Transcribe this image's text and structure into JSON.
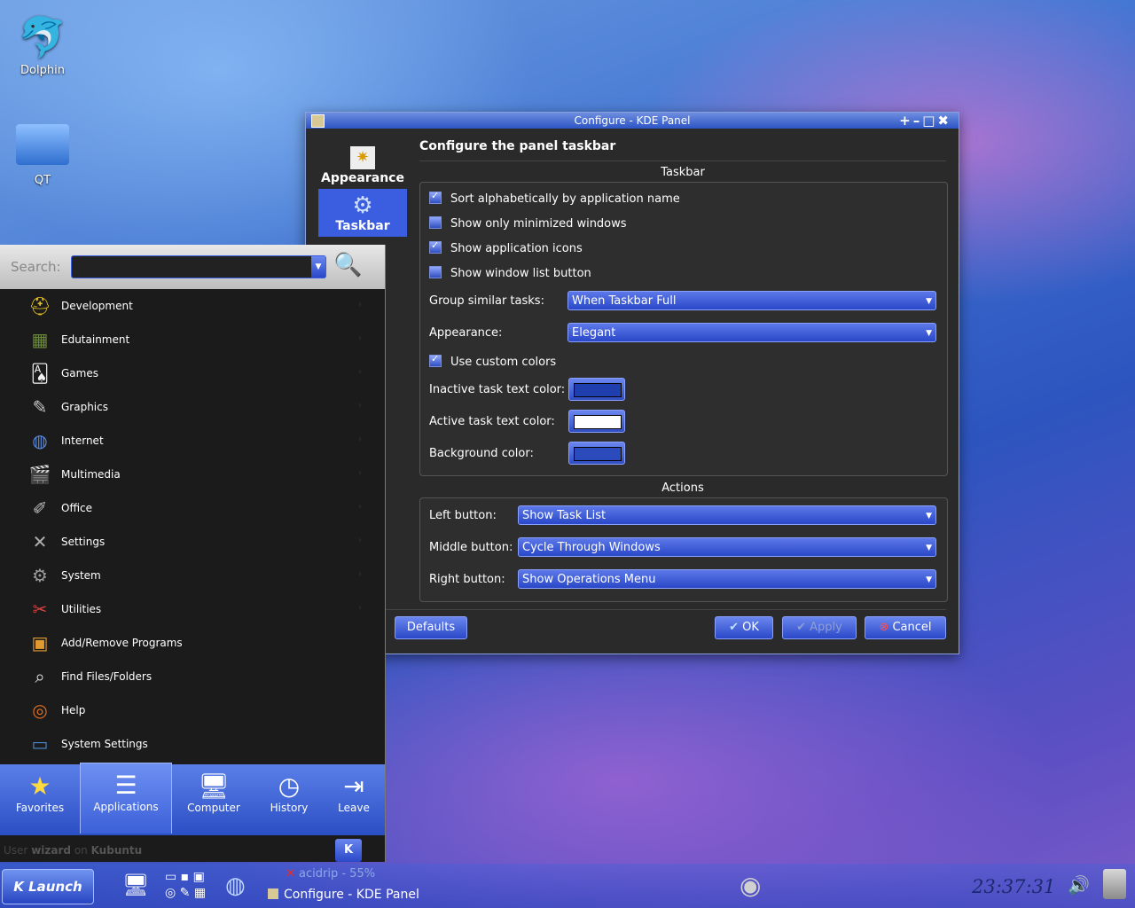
{
  "desktop": {
    "icons": [
      {
        "label": "Dolphin",
        "icon": "dolphin-icon"
      },
      {
        "label": "QT",
        "icon": "folder-icon"
      }
    ]
  },
  "dialog": {
    "title": "Configure - KDE Panel",
    "nav": [
      {
        "label": "Appearance",
        "icon": "appearance-icon"
      },
      {
        "label": "Taskbar",
        "icon": "kde-taskbar-icon",
        "selected": true
      }
    ],
    "header": "Configure the panel taskbar",
    "taskbar_group": {
      "title": "Taskbar",
      "checkboxes": [
        {
          "label": "Sort alphabetically by application name",
          "checked": true
        },
        {
          "label": "Show only minimized windows",
          "checked": false
        },
        {
          "label": "Show application icons",
          "checked": true
        },
        {
          "label": "Show window list button",
          "checked": false
        }
      ],
      "group_label": "Group similar tasks:",
      "group_value": "When Taskbar Full",
      "appearance_label": "Appearance:",
      "appearance_value": "Elegant",
      "custom_colors_label": "Use custom colors",
      "custom_colors_checked": true,
      "inactive_label": "Inactive task text color:",
      "inactive_color": "#1f3fae",
      "active_label": "Active task text color:",
      "active_color": "#ffffff",
      "background_label": "Background color:",
      "background_color": "#2b4bbd"
    },
    "actions_group": {
      "title": "Actions",
      "left_label": "Left button:",
      "left_value": "Show Task List",
      "middle_label": "Middle button:",
      "middle_value": "Cycle Through Windows",
      "right_label": "Right button:",
      "right_value": "Show Operations Menu"
    },
    "buttons": {
      "defaults": "Defaults",
      "ok": "OK",
      "apply": "Apply",
      "cancel": "Cancel"
    }
  },
  "menu": {
    "search_label": "Search:",
    "search_value": "",
    "items": [
      {
        "label": "Development",
        "icon": "hardhat-icon",
        "color": "#e8c020"
      },
      {
        "label": "Edutainment",
        "icon": "chalkboard-icon",
        "color": "#6a8a3a"
      },
      {
        "label": "Games",
        "icon": "cards-icon",
        "color": "#f2f2f2"
      },
      {
        "label": "Graphics",
        "icon": "brush-icon",
        "color": "#c9c9c9"
      },
      {
        "label": "Internet",
        "icon": "globe-icon",
        "color": "#5a8be0"
      },
      {
        "label": "Multimedia",
        "icon": "clapperboard-icon",
        "color": "#666666"
      },
      {
        "label": "Office",
        "icon": "pencil-cup-icon",
        "color": "#b8b8b8"
      },
      {
        "label": "Settings",
        "icon": "tools-icon",
        "color": "#b0b0b0"
      },
      {
        "label": "System",
        "icon": "gear-icon",
        "color": "#9a9a9a"
      },
      {
        "label": "Utilities",
        "icon": "scissors-icon",
        "color": "#d94040"
      },
      {
        "label": "Add/Remove Programs",
        "icon": "package-icon",
        "color": "#e09a30"
      },
      {
        "label": "Find Files/Folders",
        "icon": "magnifier-icon",
        "color": "#e0e0e0"
      },
      {
        "label": "Help",
        "icon": "lifebuoy-icon",
        "color": "#e07020"
      },
      {
        "label": "System Settings",
        "icon": "monitor-icon",
        "color": "#4a8ad0"
      }
    ],
    "tabs": [
      {
        "label": "Favorites",
        "icon": "star-icon"
      },
      {
        "label": "Applications",
        "icon": "list-icon",
        "selected": true
      },
      {
        "label": "Computer",
        "icon": "computer-icon"
      },
      {
        "label": "History",
        "icon": "clock-icon"
      },
      {
        "label": "Leave",
        "icon": "exit-icon"
      }
    ],
    "user_prefix": "User",
    "user_name": "wizard",
    "user_on": "on",
    "host": "Kubuntu"
  },
  "panel": {
    "launch_label": "Launch",
    "task1": "acidrip - 55%",
    "task2": "Configure - KDE Panel",
    "clock": "23:37:31"
  }
}
